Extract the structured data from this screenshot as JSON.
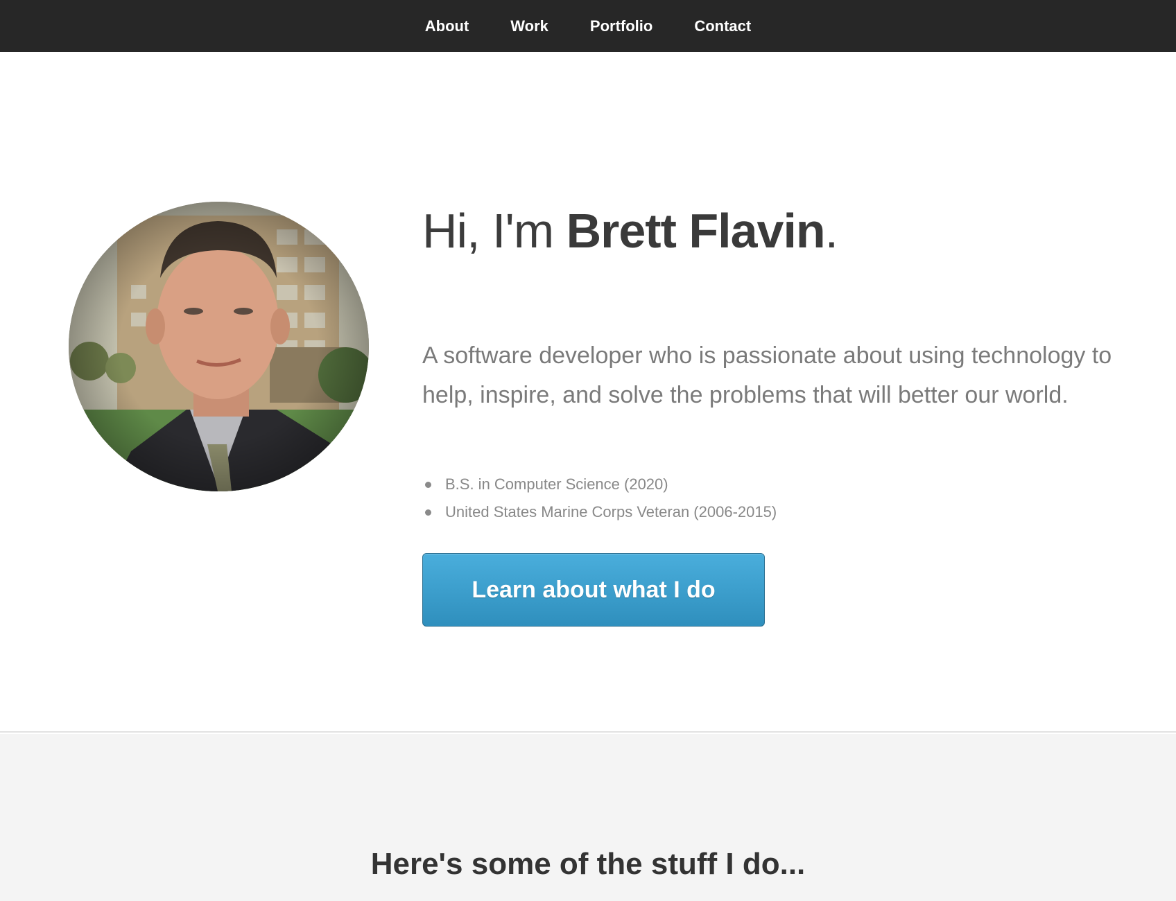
{
  "nav": {
    "items": [
      {
        "label": "About"
      },
      {
        "label": "Work"
      },
      {
        "label": "Portfolio"
      },
      {
        "label": "Contact"
      }
    ]
  },
  "hero": {
    "greeting": "Hi, I'm ",
    "name": "Brett Flavin",
    "period": ".",
    "tagline": "A software developer who is passionate about using technology to help, inspire, and solve the problems that will better our world.",
    "facts": [
      "B.S. in Computer Science (2020)",
      "United States Marine Corps Veteran (2006-2015)"
    ],
    "cta_label": "Learn about what I do"
  },
  "section2": {
    "title": "Here's some of the stuff I do..."
  },
  "colors": {
    "nav_bg": "#272727",
    "cta_blue": "#3a9fcd",
    "section2_bg": "#f4f4f4"
  }
}
